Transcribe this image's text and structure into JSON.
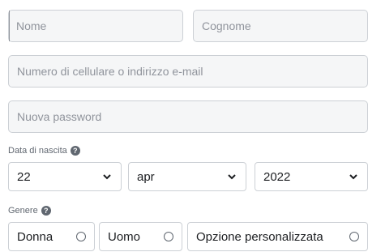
{
  "form": {
    "first_name_placeholder": "Nome",
    "last_name_placeholder": "Cognome",
    "contact_placeholder": "Numero di cellulare o indirizzo e-mail",
    "password_placeholder": "Nuova password"
  },
  "birthday": {
    "label": "Data di nascita",
    "day": "22",
    "month": "apr",
    "year": "2022"
  },
  "gender": {
    "label": "Genere",
    "options": [
      {
        "label": "Donna"
      },
      {
        "label": "Uomo"
      },
      {
        "label": "Opzione personalizzata"
      }
    ]
  },
  "icons": {
    "help": "?"
  }
}
